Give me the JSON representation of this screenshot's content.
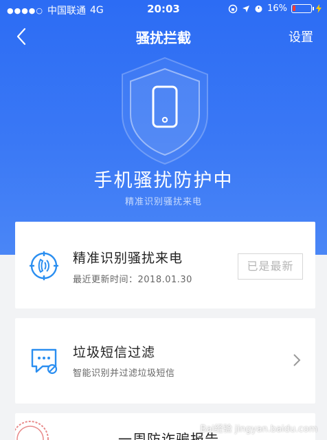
{
  "status_bar": {
    "signal": "●●●●○",
    "carrier": "中国联通",
    "network": "4G",
    "time": "20:03",
    "battery_percent": "16%",
    "battery_level": 0.16
  },
  "nav": {
    "title": "骚扰拦截",
    "settings_label": "设置"
  },
  "hero": {
    "title": "手机骚扰防护中",
    "subtitle": "精准识别骚扰来电"
  },
  "cards": {
    "call_id": {
      "title": "精准识别骚扰来电",
      "subtitle": "最近更新时间：2018.01.30",
      "button_label": "已是最新"
    },
    "sms_filter": {
      "title": "垃圾短信过滤",
      "subtitle": "智能识别并过滤垃圾短信"
    },
    "weekly_report": {
      "title": "一周防诈骗报告"
    }
  },
  "watermark": "Bai经验 jingyan.baidu.com",
  "colors": {
    "hero_blue": "#2c6cf4",
    "icon_blue": "#2a8ef0",
    "battery_red": "#ff3b30"
  }
}
